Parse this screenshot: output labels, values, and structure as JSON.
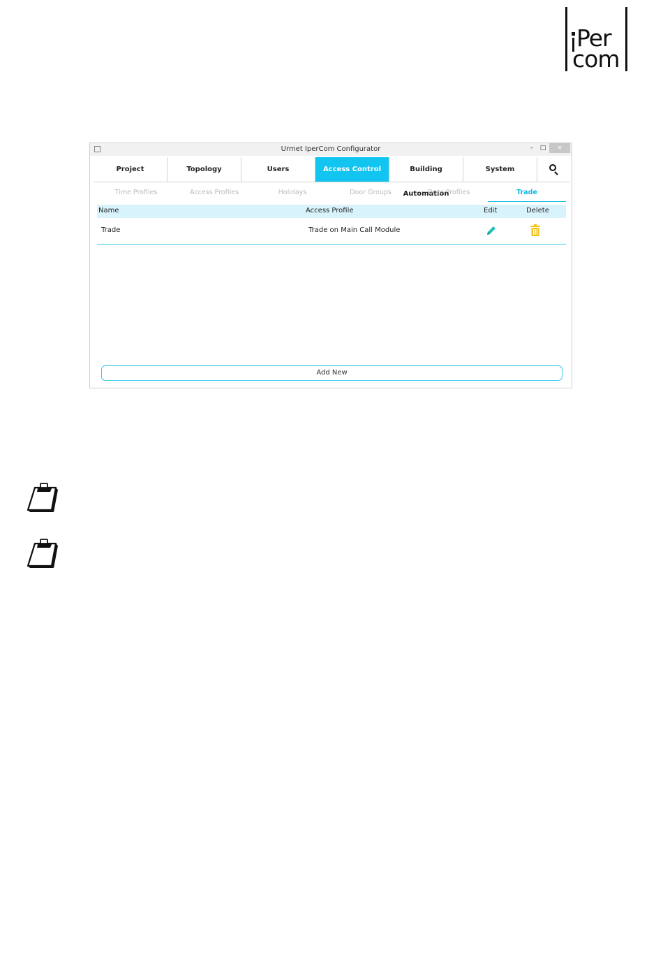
{
  "logo": {
    "line1": "Per",
    "line2": "com"
  },
  "window": {
    "title": "Urmet IperCom Configurator",
    "controls": {
      "minimize": "–",
      "maximize": "□",
      "close": "×"
    }
  },
  "main_tabs": [
    {
      "label": "Project"
    },
    {
      "label": "Topology"
    },
    {
      "label": "Users"
    },
    {
      "label": "Access Control"
    },
    {
      "label": "Building Automation"
    },
    {
      "label": "System"
    }
  ],
  "sub_tabs": [
    {
      "label": "Time Profiles"
    },
    {
      "label": "Access Profiles"
    },
    {
      "label": "Holidays"
    },
    {
      "label": "Door Groups"
    },
    {
      "label": "Door Profiles"
    },
    {
      "label": "Trade"
    }
  ],
  "table": {
    "columns": [
      "Name",
      "Access Profile",
      "Edit",
      "Delete"
    ],
    "rows": [
      {
        "name": "Trade",
        "access_profile": "Trade on Main Call Module"
      }
    ]
  },
  "add_new_label": "Add New",
  "colors": {
    "accent": "#12c4f0",
    "edit": "#1fc2b8",
    "delete": "#f2c21a"
  },
  "icons": [
    "search-icon",
    "pencil-icon",
    "trash-icon",
    "clipboard-note-icon"
  ]
}
